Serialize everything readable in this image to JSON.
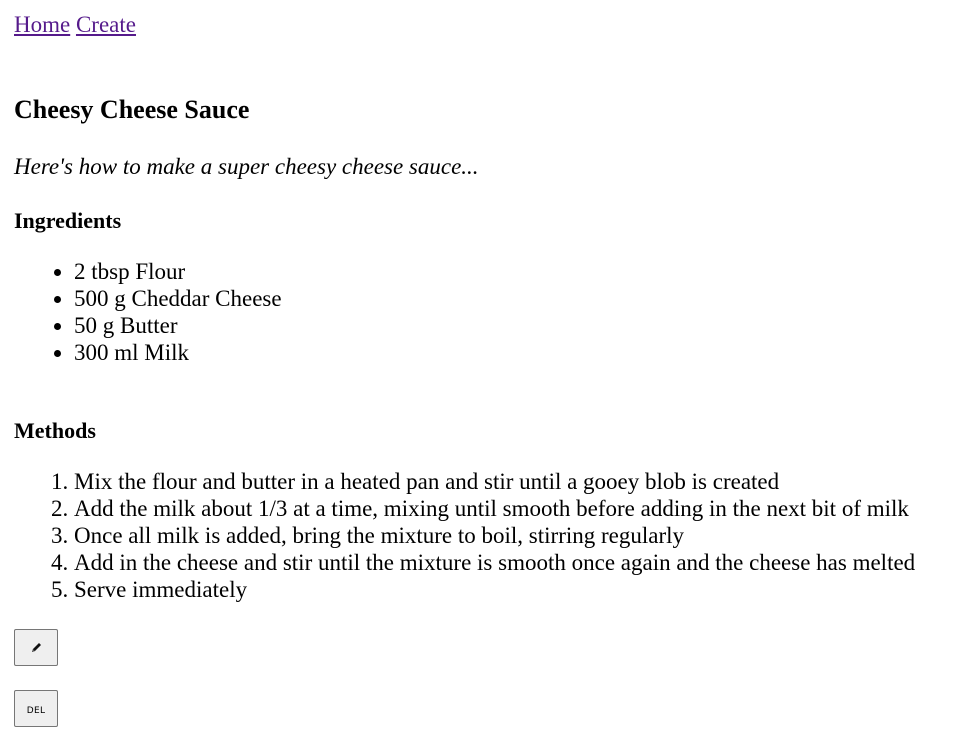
{
  "nav": {
    "home_label": "Home",
    "create_label": "Create"
  },
  "recipe": {
    "title": "Cheesy Cheese Sauce",
    "description": "Here's how to make a super cheesy cheese sauce...",
    "ingredients_heading": "Ingredients",
    "ingredients": [
      "2 tbsp Flour",
      "500 g Cheddar Cheese",
      "50 g Butter",
      "300 ml Milk"
    ],
    "methods_heading": "Methods",
    "methods": [
      "Mix the flour and butter in a heated pan and stir until a gooey blob is created",
      "Add the milk about 1/3 at a time, mixing until smooth before adding in the next bit of milk",
      "Once all milk is added, bring the mixture to boil, stirring regularly",
      "Add in the cheese and stir until the mixture is smooth once again and the cheese has melted",
      "Serve immediately"
    ]
  },
  "actions": {
    "edit_icon": "pencil-icon",
    "delete_label": "DEL"
  }
}
